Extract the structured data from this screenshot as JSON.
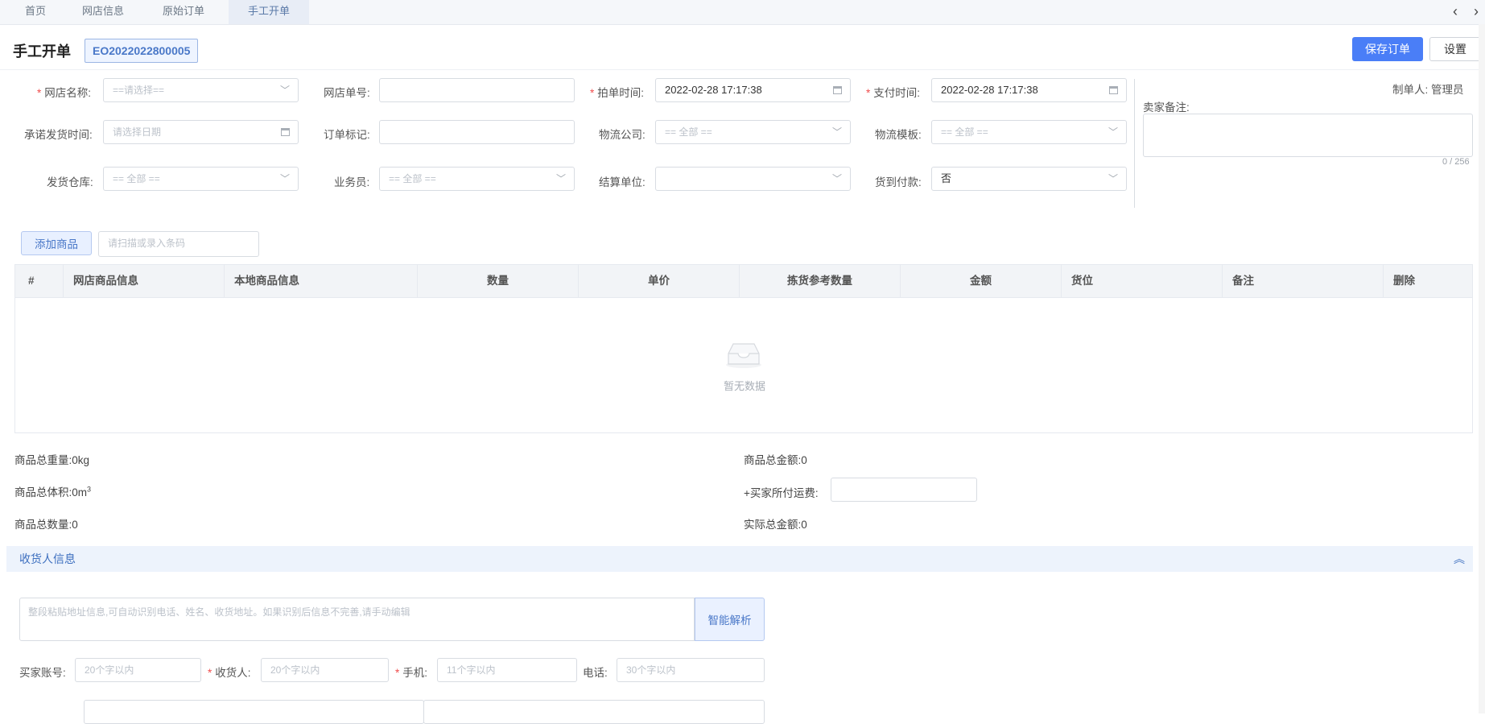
{
  "tabs": [
    "首页",
    "网店信息",
    "原始订单",
    "手工开单"
  ],
  "header": {
    "title": "手工开单",
    "order_no": "EO2022022800005",
    "save_label": "保存订单",
    "settings_label": "设置"
  },
  "form": {
    "shop_name": {
      "label": "网店名称:",
      "placeholder": "==请选择=="
    },
    "shop_order_no": {
      "label": "网店单号:"
    },
    "order_time": {
      "label": "拍单时间:",
      "value": "2022-02-28 17:17:38"
    },
    "pay_time": {
      "label": "支付时间:",
      "value": "2022-02-28 17:17:38"
    },
    "promise_ship_time": {
      "label": "承诺发货时间:",
      "placeholder": "请选择日期"
    },
    "order_flag": {
      "label": "订单标记:"
    },
    "logistics_company": {
      "label": "物流公司:",
      "placeholder": "== 全部 =="
    },
    "logistics_template": {
      "label": "物流模板:",
      "placeholder": "== 全部 =="
    },
    "warehouse": {
      "label": "发货仓库:",
      "placeholder": "== 全部 =="
    },
    "salesman": {
      "label": "业务员:",
      "placeholder": "== 全部 =="
    },
    "settlement_unit": {
      "label": "结算单位:"
    },
    "cod": {
      "label": "货到付款:",
      "value": "否"
    }
  },
  "side": {
    "maker_label": "制单人:",
    "maker_value": "管理员",
    "seller_remark_label": "卖家备注:",
    "counter": "0 / 256"
  },
  "goods": {
    "add_label": "添加商品",
    "scan_placeholder": "请扫描或录入条码",
    "columns": [
      "#",
      "网店商品信息",
      "本地商品信息",
      "数量",
      "单价",
      "拣货参考数量",
      "金额",
      "货位",
      "备注",
      "删除"
    ],
    "empty_text": "暂无数据"
  },
  "totals": {
    "weight": "商品总重量:0kg",
    "volume_prefix": "商品总体积:0m",
    "volume_sup": "3",
    "quantity": "商品总数量:0",
    "amount": "商品总金额:0",
    "shipping_fee_label": "+买家所付运费:",
    "actual_amount": "实际总金额:0"
  },
  "receiver": {
    "section_title": "收货人信息",
    "paste_placeholder": "整段粘贴地址信息,可自动识别电话、姓名、收货地址。如果识别后信息不完善,请手动编辑",
    "parse_label": "智能解析",
    "buyer_account": {
      "label": "买家账号:",
      "placeholder": "20个字以内"
    },
    "receiver_name": {
      "label": "收货人:",
      "placeholder": "20个字以内"
    },
    "mobile": {
      "label": "手机:",
      "placeholder": "11个字以内"
    },
    "phone": {
      "label": "电话:",
      "placeholder": "30个字以内"
    }
  }
}
